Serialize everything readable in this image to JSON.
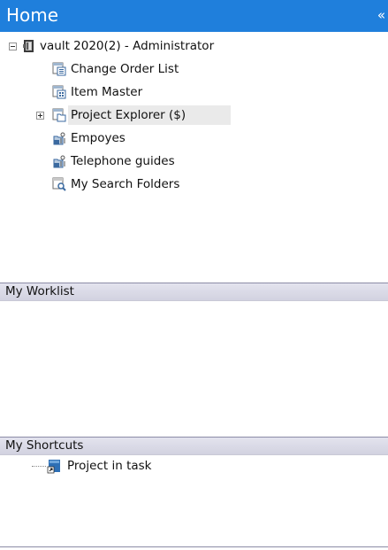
{
  "header": {
    "title": "Home",
    "collapse_glyph": "«"
  },
  "tree": {
    "root": {
      "label": "vault 2020(2) - Administrator",
      "icon": "vault-icon",
      "expanded": true
    },
    "items": [
      {
        "label": "Change Order List",
        "icon": "change-order-list-icon"
      },
      {
        "label": "Item Master",
        "icon": "item-master-icon"
      },
      {
        "label": "Project Explorer ($)",
        "icon": "project-explorer-icon",
        "expandable": true,
        "selected": true
      },
      {
        "label": "Empoyes",
        "icon": "saved-search-icon"
      },
      {
        "label": "Telephone guides",
        "icon": "saved-search-icon"
      },
      {
        "label": "My Search Folders",
        "icon": "search-folder-icon"
      }
    ]
  },
  "worklist": {
    "title": "My Worklist"
  },
  "shortcuts": {
    "title": "My Shortcuts",
    "items": [
      {
        "label": "Project in task",
        "icon": "shortcut-icon"
      }
    ]
  },
  "colors": {
    "header_bg": "#1f7fdc",
    "section_bar": "#d8d8e6",
    "selection": "#eaeaea"
  }
}
